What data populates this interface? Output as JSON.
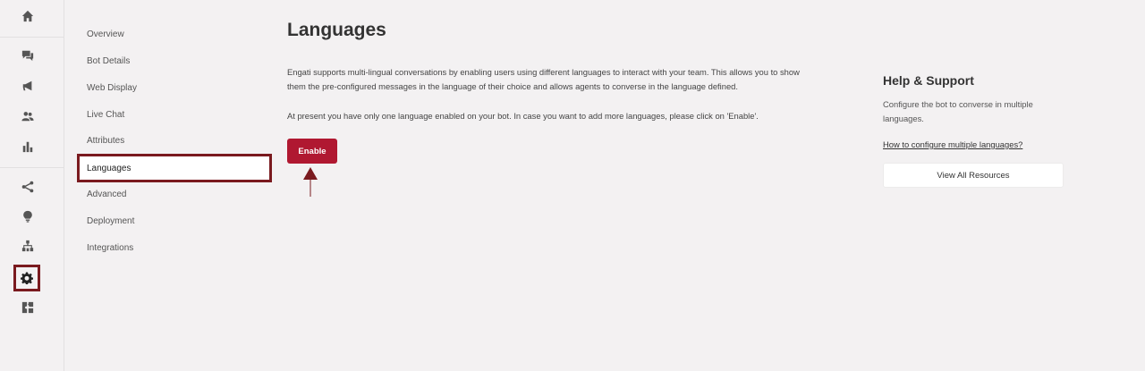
{
  "rail": {
    "icons": [
      "home-icon",
      "chat-icon",
      "megaphone-icon",
      "users-icon",
      "bar-chart-icon",
      "flow-icon",
      "bulb-icon",
      "hierarchy-icon",
      "gear-icon",
      "puzzle-icon"
    ],
    "active": "gear-icon",
    "active_border_color": "#7a1a1f"
  },
  "subnav": {
    "items": [
      "Overview",
      "Bot Details",
      "Web Display",
      "Live Chat",
      "Attributes",
      "Languages",
      "Advanced",
      "Deployment",
      "Integrations"
    ],
    "active": "Languages"
  },
  "main": {
    "title": "Languages",
    "description": "Engati supports multi-lingual conversations by enabling users using different languages to interact with your team. This allows you to show them the pre-configured messages in the language of their choice and allows agents to converse in the language defined.",
    "info": "At present you have only one language enabled on your bot. In case you want to add more languages, please click on 'Enable'.",
    "enable_label": "Enable",
    "accent_color": "#b01831"
  },
  "help": {
    "title": "Help & Support",
    "text": "Configure the bot to converse in multiple languages.",
    "link": "How to configure multiple languages?",
    "button": "View All Resources"
  }
}
